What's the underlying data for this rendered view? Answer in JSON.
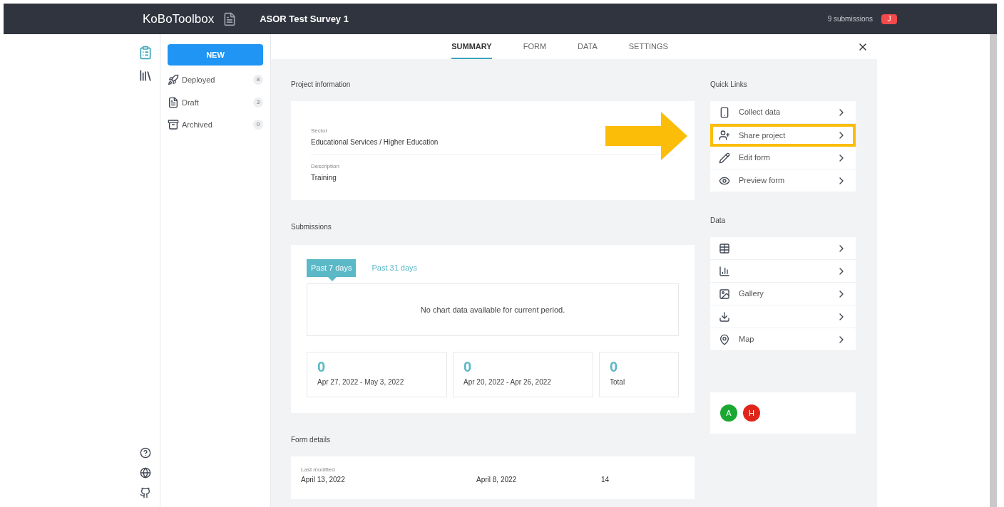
{
  "header": {
    "logo": "KoBoToolbox",
    "project_title": "ASOR Test Survey 1",
    "submissions": "9 submissions",
    "user_initial": "J"
  },
  "sidebar": {
    "new_button": "NEW",
    "items": [
      {
        "label": "Deployed",
        "count": "8",
        "kind": "deployed"
      },
      {
        "label": "Draft",
        "count": "3",
        "kind": "draft"
      },
      {
        "label": "Archived",
        "count": "0",
        "kind": "archived"
      }
    ]
  },
  "tabs": [
    {
      "label": "SUMMARY",
      "selected": true
    },
    {
      "label": "FORM",
      "selected": false
    },
    {
      "label": "DATA",
      "selected": false
    },
    {
      "label": "SETTINGS",
      "selected": false
    }
  ],
  "project_information": {
    "title": "Project information",
    "fields": [
      {
        "label": "Sector",
        "value": "Educational Services / Higher Education"
      },
      {
        "label": "Description",
        "value": "Training"
      }
    ]
  },
  "submissions": {
    "title": "Submissions",
    "periods": [
      {
        "label": "Past 7 days",
        "selected": true
      },
      {
        "label": "Past 31 days",
        "selected": false
      }
    ],
    "empty_message": "No chart data available for current period.",
    "stats": [
      {
        "value": "0",
        "label": "Apr 27, 2022 - May 3, 2022"
      },
      {
        "value": "0",
        "label": "Apr 20, 2022 - Apr 26, 2022"
      },
      {
        "value": "0",
        "label": "Total"
      }
    ]
  },
  "form_details": {
    "title": "Form details",
    "columns": [
      {
        "label": "Last modified",
        "value": "April 13, 2022"
      },
      {
        "value": "April 8, 2022"
      },
      {
        "value": "14"
      }
    ]
  },
  "quick_links": {
    "title": "Quick Links",
    "items": [
      {
        "label": "Collect data",
        "kind": "collect",
        "highlighted": false
      },
      {
        "label": "Share project",
        "kind": "share",
        "highlighted": true
      },
      {
        "label": "Edit form",
        "kind": "edit",
        "highlighted": false
      },
      {
        "label": "Preview form",
        "kind": "preview",
        "highlighted": false
      }
    ]
  },
  "data_links": {
    "title": "Data",
    "items": [
      {
        "kind": "table"
      },
      {
        "kind": "reports"
      },
      {
        "label": "Gallery",
        "kind": "gallery"
      },
      {
        "kind": "downloads"
      },
      {
        "label": "Map",
        "kind": "map"
      }
    ]
  },
  "team": {
    "members": [
      {
        "initial": "A",
        "color": "#1aa832"
      },
      {
        "initial": "H",
        "color": "#e0251b"
      }
    ]
  }
}
